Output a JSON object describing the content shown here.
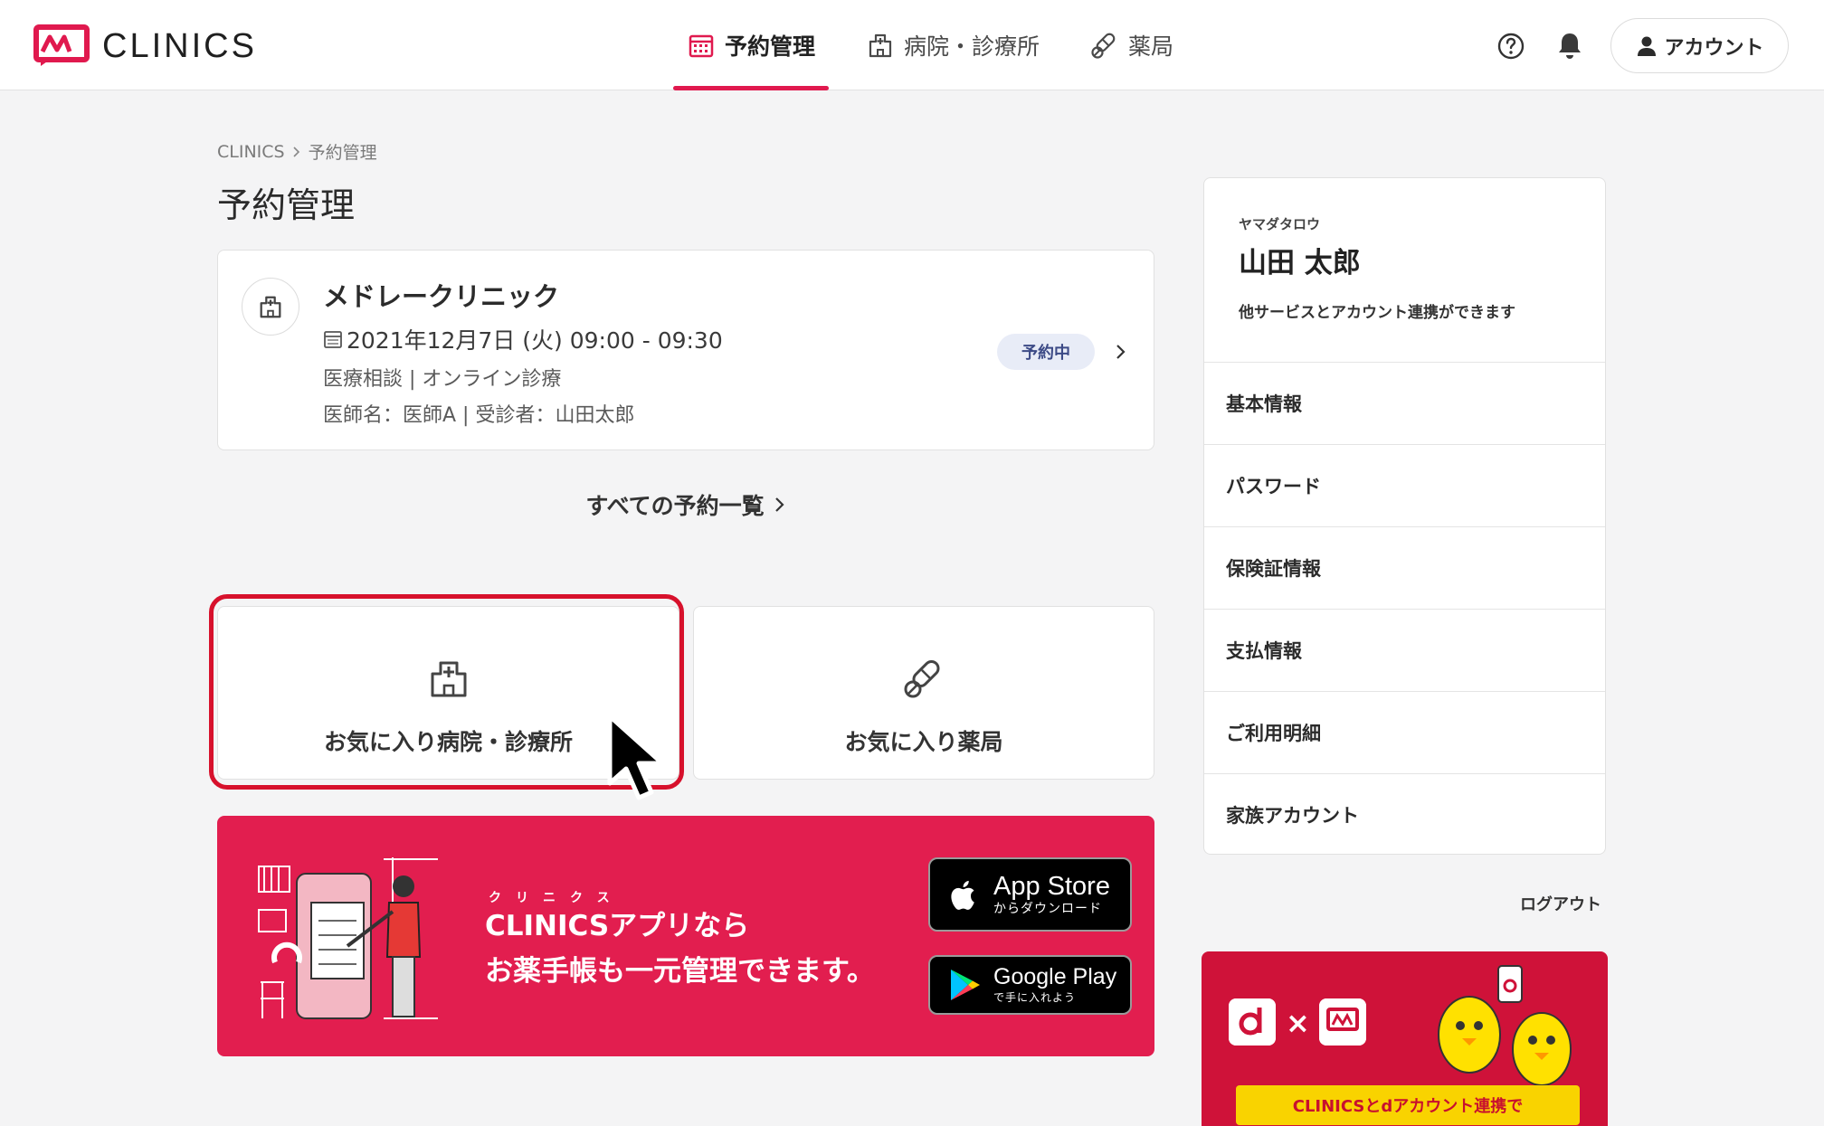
{
  "header": {
    "logo_text": "CLINICS",
    "nav": [
      {
        "label": "予約管理",
        "icon": "calendar-icon",
        "active": true
      },
      {
        "label": "病院・診療所",
        "icon": "hospital-icon",
        "active": false
      },
      {
        "label": "薬局",
        "icon": "pill-icon",
        "active": false
      }
    ],
    "account_label": "アカウント"
  },
  "breadcrumb": {
    "root": "CLINICS",
    "current": "予約管理"
  },
  "page_title": "予約管理",
  "appointment": {
    "clinic_name": "メドレークリニック",
    "date": "2021年12月7日 (火) 09:00 - 09:30",
    "type": "医療相談 | オンライン診療",
    "doctor": "医師名：医師A | 受診者：山田太郎",
    "status": "予約中"
  },
  "all_appointments_link": "すべての予約一覧",
  "favorites": {
    "clinic_label": "お気に入り病院・診療所",
    "pharmacy_label": "お気に入り薬局"
  },
  "app_banner": {
    "ruby": "クリニクス",
    "line1": "CLINICSアプリなら",
    "line2": "お薬手帳も一元管理できます。",
    "appstore_main": "App Store",
    "appstore_sub": "からダウンロード",
    "gplay_main": "Google Play",
    "gplay_sub": "で手に入れよう"
  },
  "profile": {
    "kana": "ヤマダタロウ",
    "name": "山田 太郎",
    "note": "他サービスとアカウント連携ができます"
  },
  "side_menu": [
    "基本情報",
    "パスワード",
    "保険証情報",
    "支払情報",
    "ご利用明細",
    "家族アカウント"
  ],
  "logout_label": "ログアウト",
  "dpoint_banner": {
    "ribbon": "CLINICSとdアカウント連携で"
  },
  "colors": {
    "accent": "#e0194e",
    "highlight": "#d7112c",
    "banner": "#e21e4f",
    "badge_bg": "#e8ecf7",
    "badge_text": "#3c4a86"
  }
}
